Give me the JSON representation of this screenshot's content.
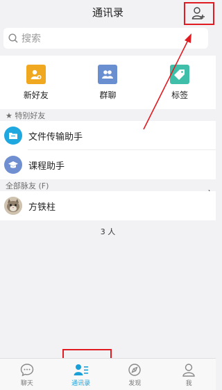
{
  "header": {
    "title": "通讯录"
  },
  "search": {
    "placeholder": "搜索"
  },
  "quick_actions": [
    {
      "label": "新好友",
      "icon": "new-friend-icon",
      "color": "#f0a821"
    },
    {
      "label": "群聊",
      "icon": "group-chat-icon",
      "color": "#6a8fd1"
    },
    {
      "label": "标签",
      "icon": "tag-icon",
      "color": "#3fbfaa"
    }
  ],
  "special_friends": {
    "header": "★ 特别好友",
    "items": [
      {
        "name": "文件传输助手",
        "icon": "folder-icon",
        "color": "#1fa8e0"
      },
      {
        "name": "课程助手",
        "icon": "graduation-cap-icon",
        "color": "#6f8fd0"
      }
    ]
  },
  "all_friends": {
    "header": "全部脉友 (F)",
    "items": [
      {
        "name": "方铁柱",
        "icon": "cat-avatar"
      }
    ]
  },
  "count_text": "3 人",
  "tabbar": {
    "tabs": [
      {
        "label": "聊天",
        "icon": "chat-bubble-icon",
        "active": false
      },
      {
        "label": "通讯录",
        "icon": "contacts-icon",
        "active": true
      },
      {
        "label": "发现",
        "icon": "compass-icon",
        "active": false
      },
      {
        "label": "我",
        "icon": "person-icon",
        "active": false
      }
    ]
  },
  "colors": {
    "accent": "#1aa0d8",
    "annotation": "#e11b22"
  },
  "edge_marker": "〉"
}
